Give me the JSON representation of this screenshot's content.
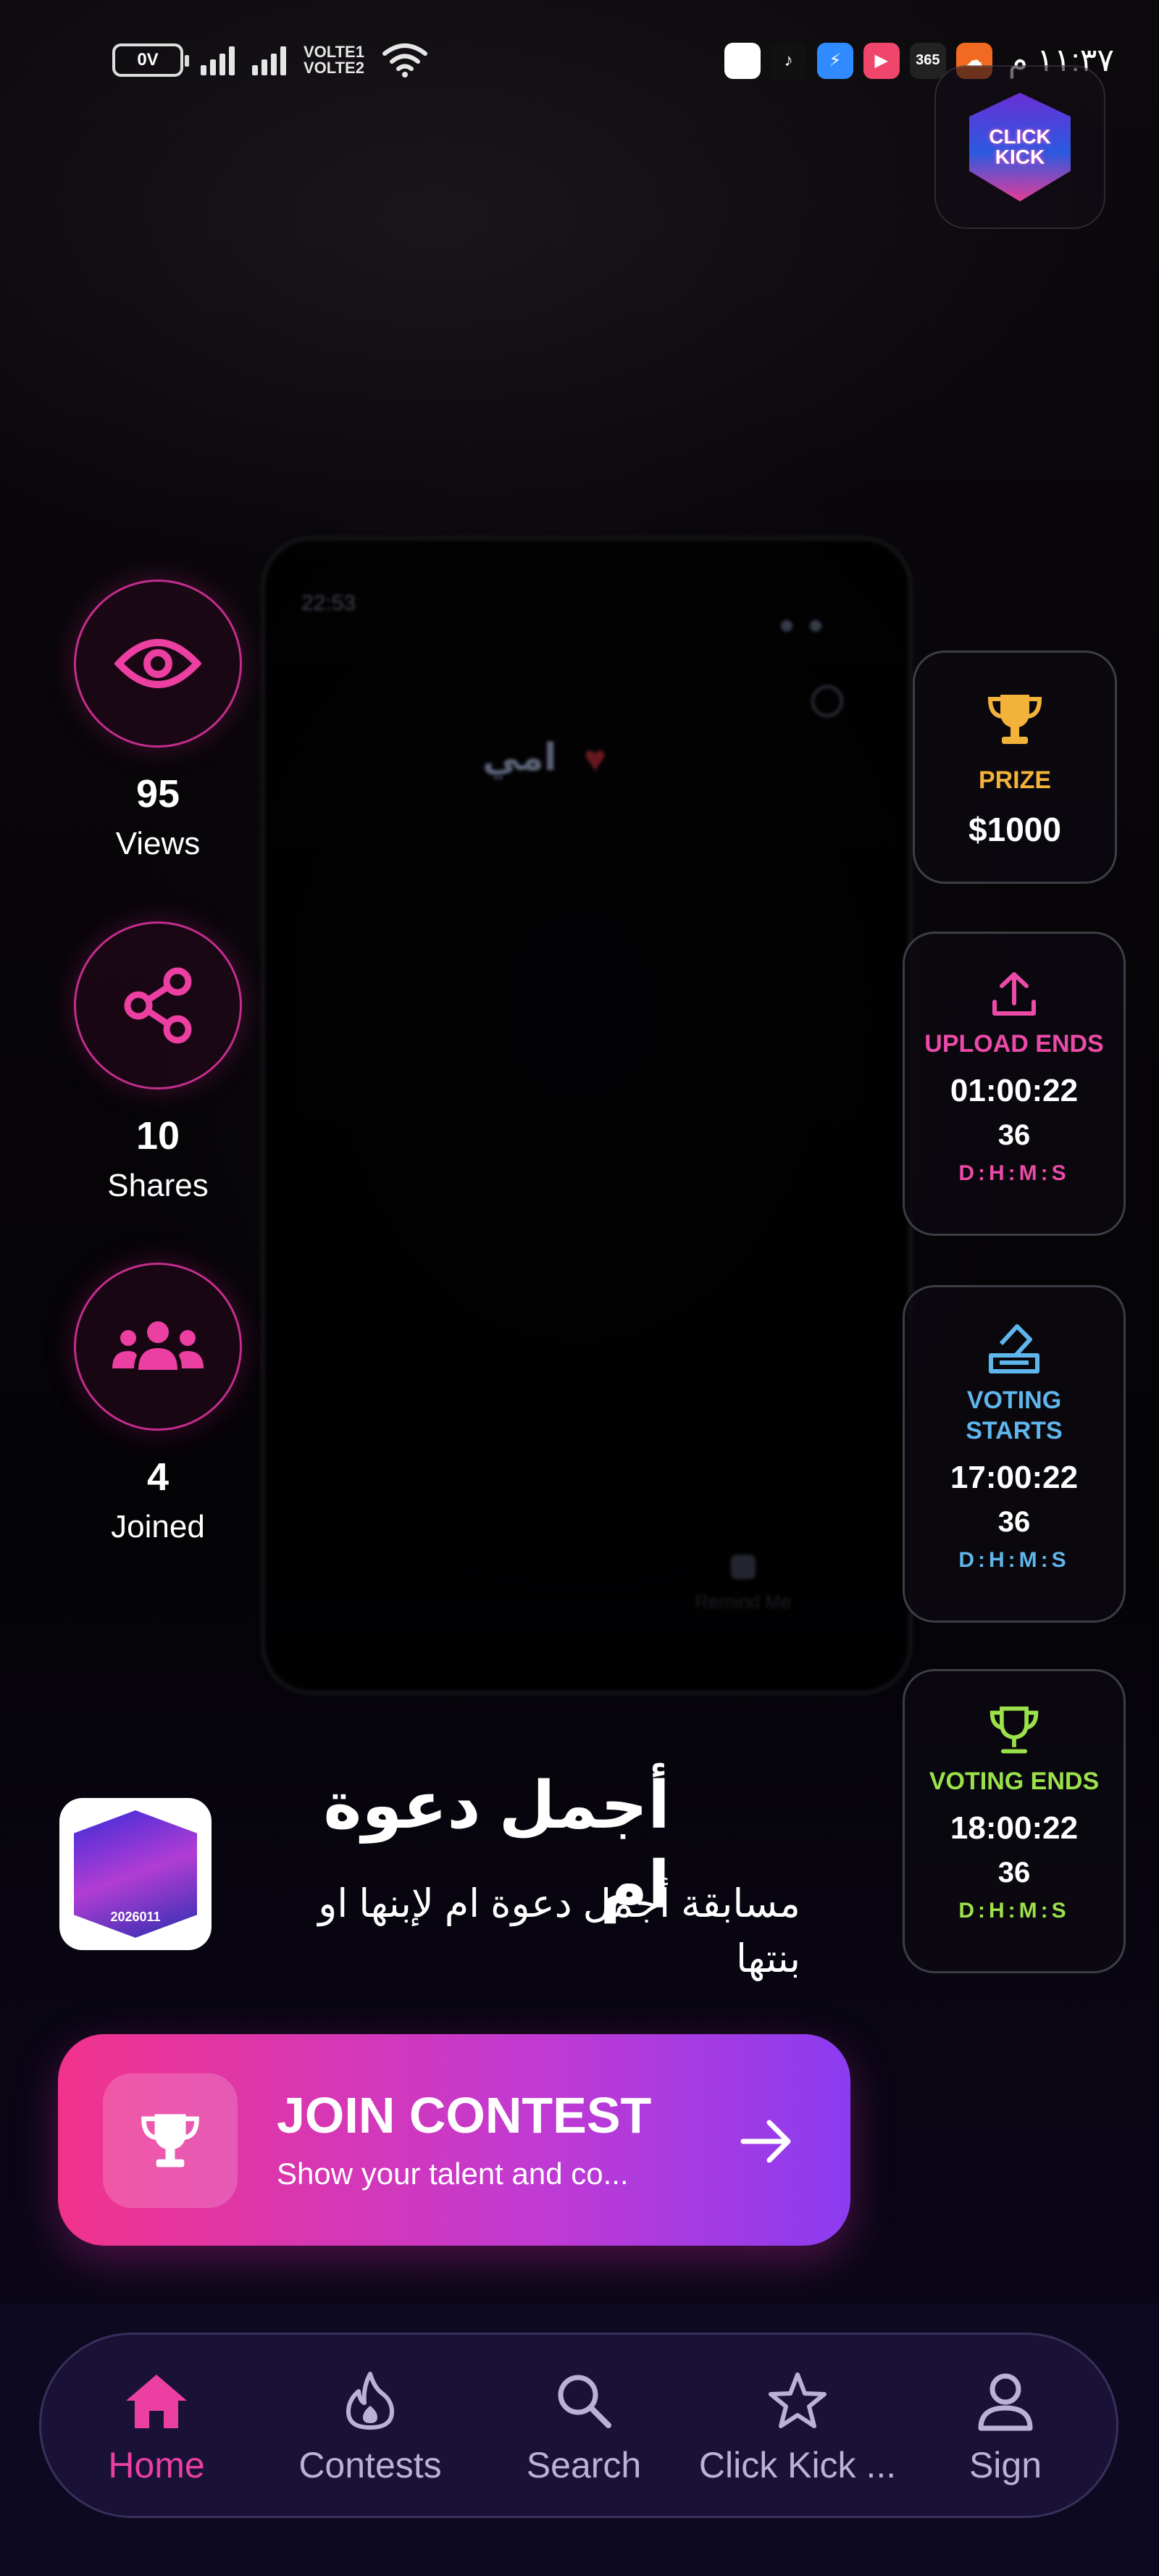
{
  "background_video": {
    "title": "امي",
    "time": "22:53",
    "caption": "Remind Me"
  },
  "status_bar": {
    "battery": "0V",
    "network_labels": [
      "VOLTE",
      "VOLTE"
    ],
    "network_badges": [
      "1",
      "2"
    ],
    "notification_icons": [
      "white-app-icon",
      "tiktok-icon",
      "messenger-icon",
      "podcast-icon",
      "365-icon",
      "cloud-app-icon"
    ],
    "app_365_label": "365",
    "clock": "١١:٣٧ م"
  },
  "logo": {
    "line1": "CLICK",
    "line2": "KICK"
  },
  "stats": [
    {
      "icon": "eye-icon",
      "value": "95",
      "label": "Views"
    },
    {
      "icon": "share-icon",
      "value": "10",
      "label": "Shares"
    },
    {
      "icon": "group-icon",
      "value": "4",
      "label": "Joined"
    }
  ],
  "prize": {
    "label": "PRIZE",
    "amount": "$1000"
  },
  "timeline": {
    "upload_ends": {
      "label": "UPLOAD ENDS",
      "time": "01:00:22",
      "days": "36",
      "format": "D:H:M:S"
    },
    "voting_starts": {
      "label": "VOTING STARTS",
      "time": "17:00:22",
      "days": "36",
      "format": "D:H:M:S"
    },
    "voting_ends": {
      "label": "VOTING ENDS",
      "time": "18:00:22",
      "days": "36",
      "format": "D:H:M:S"
    }
  },
  "contest": {
    "thumbnail_label": "2026011",
    "title": "أجمل دعوة ام",
    "description": "مسابقة أجمل دعوة ام لإبنها او بنتها"
  },
  "join_button": {
    "title": "JOIN CONTEST",
    "subtitle": "Show your talent and co..."
  },
  "nav": {
    "active": "Home",
    "items": [
      {
        "label": "Home",
        "icon": "home-icon"
      },
      {
        "label": "Contests",
        "icon": "fire-icon"
      },
      {
        "label": "Search",
        "icon": "search-icon"
      },
      {
        "label": "Click Kick ...",
        "icon": "star-icon"
      },
      {
        "label": "Sign",
        "icon": "user-icon"
      }
    ]
  },
  "colors": {
    "accent_pink": "#ec3fa2",
    "prize_gold": "#f3b23a",
    "upload_pink": "#ec4aa8",
    "voting_blue": "#5fb6ec",
    "voting_green": "#9be24a",
    "nav_bg": "#1a1236"
  }
}
